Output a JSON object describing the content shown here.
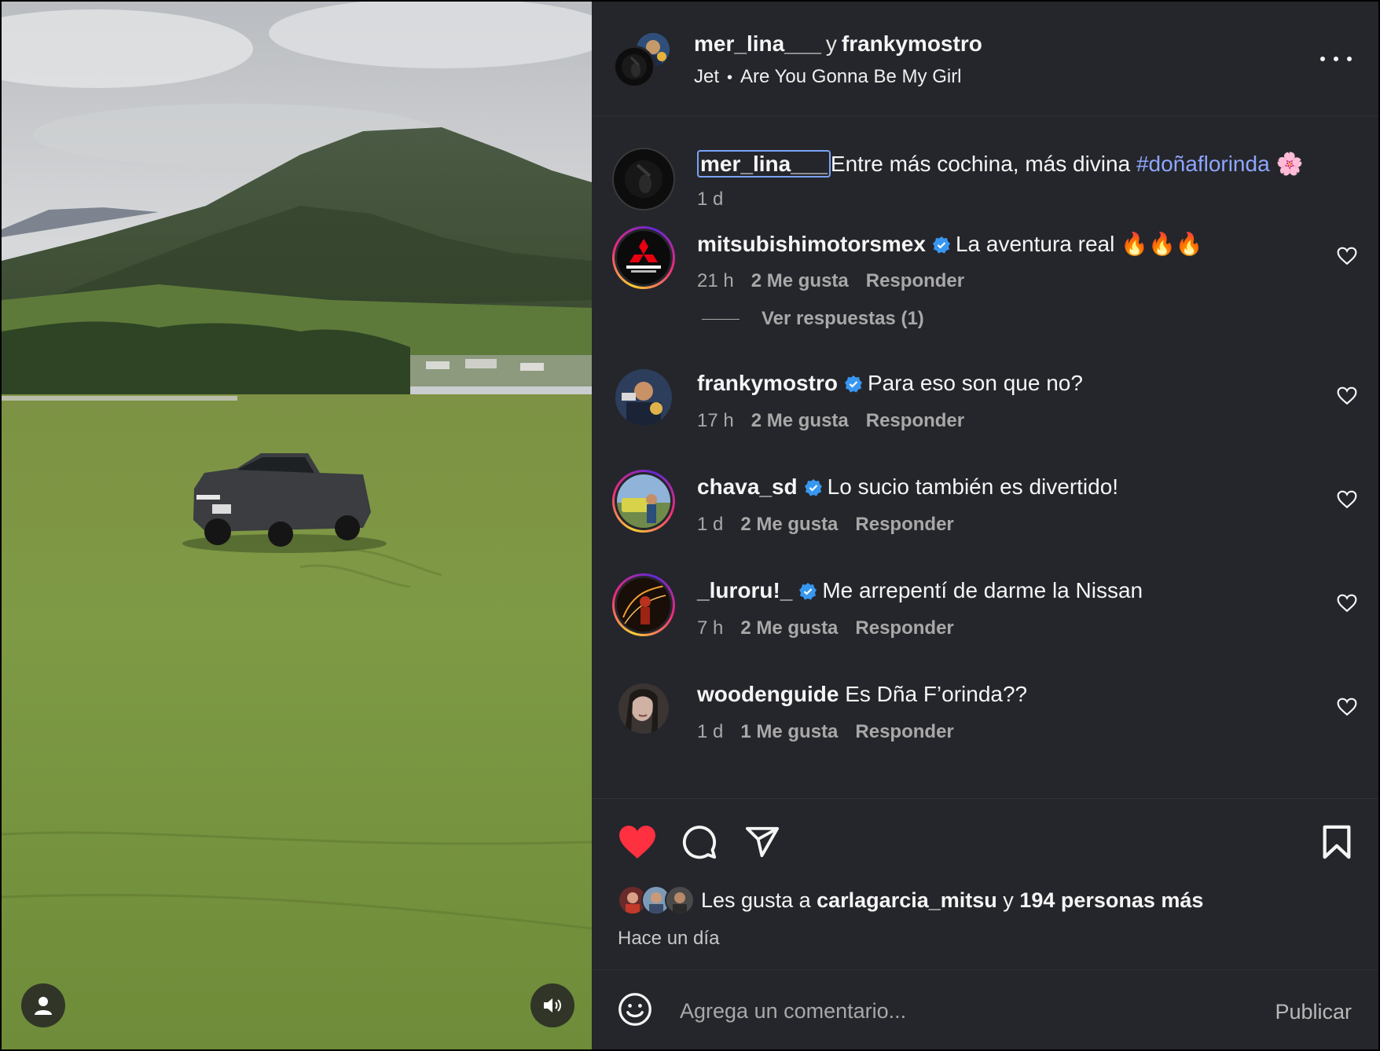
{
  "header": {
    "user1": "mer_lina___",
    "conjunction": "y",
    "user2": "frankymostro",
    "artist": "Jet",
    "song": "Are You Gonna Be My Girl",
    "more_icon": "more-horizontal-icon"
  },
  "caption": {
    "user": "mer_lina___",
    "text": "Entre más cochina, más divina",
    "hashtag": "#doñaflorinda",
    "emoji": "🌸",
    "time": "1 d"
  },
  "comments": [
    {
      "user": "mitsubishimotorsmex",
      "verified": true,
      "text": "La aventura real 🔥🔥🔥",
      "time": "21 h",
      "likes": "2 Me gusta",
      "reply": "Responder"
    },
    {
      "user": "frankymostro",
      "verified": true,
      "text": "Para eso son que no?",
      "time": "17 h",
      "likes": "2 Me gusta",
      "reply": "Responder"
    },
    {
      "user": "chava_sd",
      "verified": true,
      "text": "Lo sucio también es divertido!",
      "time": "1 d",
      "likes": "2 Me gusta",
      "reply": "Responder"
    },
    {
      "user": "_luroru!_",
      "verified": true,
      "text": "Me arrepentí de darme la Nissan",
      "time": "7 h",
      "likes": "2 Me gusta",
      "reply": "Responder"
    },
    {
      "user": "woodenguide",
      "verified": false,
      "text": "Es Dña F’orinda??",
      "time": "1 d",
      "likes": "1 Me gusta",
      "reply": "Responder"
    }
  ],
  "view_replies": "Ver respuestas (1)",
  "actions": {
    "liked": true,
    "icons": [
      "heart-icon",
      "comment-icon",
      "share-icon",
      "bookmark-icon"
    ]
  },
  "likes": {
    "prefix": "Les gusta a",
    "user": "carlagarcia_mitsu",
    "conjunction": "y",
    "others": "194 personas más"
  },
  "time_ago": "Hace un día",
  "composer": {
    "placeholder": "Agrega un comentario...",
    "publish": "Publicar"
  },
  "colors": {
    "panel_bg": "#25262b",
    "like_red": "#ff3040",
    "verified_blue": "#3897f0",
    "hashtag": "#8ea6ff"
  }
}
